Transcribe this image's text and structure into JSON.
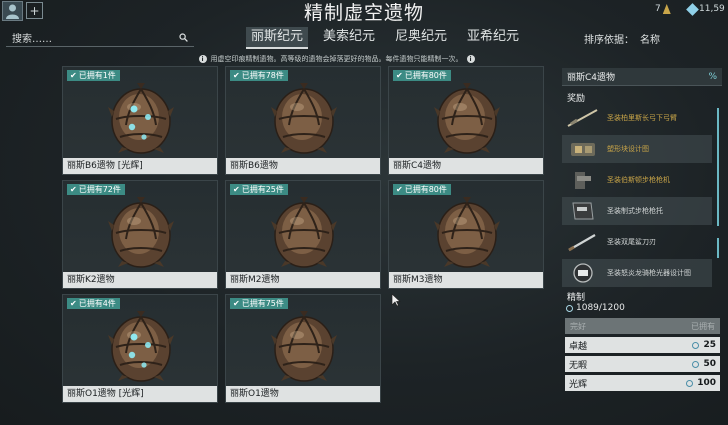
{
  "title": "精制虚空遗物",
  "currency": {
    "a": "7",
    "b": "11,59"
  },
  "search": {
    "label": "搜索……"
  },
  "tabs": [
    "丽斯纪元",
    "美索纪元",
    "尼奥纪元",
    "亚希纪元"
  ],
  "active_tab": 0,
  "sort": {
    "label": "排序依据：",
    "value": "名称"
  },
  "notice": "用虚空印痕精制遗物。高等级的遗物会掉落更好的物品。每件遗物只能精制一次。",
  "cards": [
    {
      "owned": "已拥有1件",
      "name": "丽斯B6遗物 [光辉]",
      "radiant": true
    },
    {
      "owned": "已拥有78件",
      "name": "丽斯B6遗物",
      "radiant": false
    },
    {
      "owned": "已拥有80件",
      "name": "丽斯C4遗物",
      "radiant": false
    },
    {
      "owned": "已拥有72件",
      "name": "丽斯K2遗物",
      "radiant": false
    },
    {
      "owned": "已拥有25件",
      "name": "丽斯M2遗物",
      "radiant": false
    },
    {
      "owned": "已拥有80件",
      "name": "丽斯M3遗物",
      "radiant": false
    },
    {
      "owned": "已拥有4件",
      "name": "丽斯O1遗物 [光辉]",
      "radiant": true
    },
    {
      "owned": "已拥有75件",
      "name": "丽斯O1遗物",
      "radiant": false
    }
  ],
  "panel": {
    "title": "丽斯C4遗物",
    "pct": "%",
    "rewards_title": "奖励",
    "rewards": [
      {
        "name": "圣装柏里斯长弓下弓臂",
        "tier": "gold"
      },
      {
        "name": "塑形块设计图",
        "tier": "gold"
      },
      {
        "name": "圣装伯斯顿步枪枪机",
        "tier": "gold"
      },
      {
        "name": "圣装制式步枪枪托",
        "tier": "silver"
      },
      {
        "name": "圣装双尾鲨刀刃",
        "tier": "silver"
      },
      {
        "name": "圣装怒炎龙骑枪光器设计图",
        "tier": "silver"
      }
    ],
    "refine_title": "精制",
    "refine_count": "1089/1200",
    "table_head": {
      "left": "完好",
      "right": "已拥有"
    },
    "levels": [
      {
        "name": "卓越",
        "cost": "25"
      },
      {
        "name": "无暇",
        "cost": "50"
      },
      {
        "name": "光辉",
        "cost": "100"
      }
    ]
  },
  "colors": {
    "badge": "#3c8b84",
    "accent": "#7fd0d8",
    "gold": "#c9a548"
  }
}
